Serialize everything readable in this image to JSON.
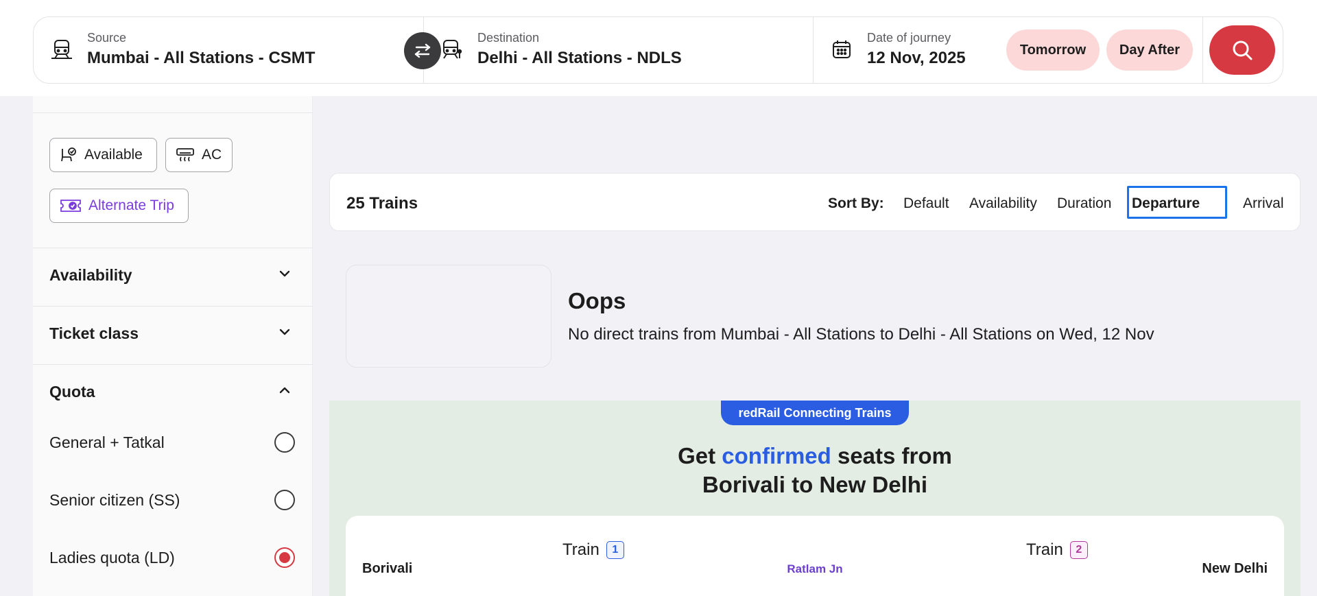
{
  "search": {
    "source": {
      "label": "Source",
      "value": "Mumbai - All Stations - CSMT",
      "icon": "train-icon"
    },
    "destination": {
      "label": "Destination",
      "value": "Delhi - All Stations - NDLS",
      "icon": "train-arrive-icon"
    },
    "date": {
      "label": "Date of journey",
      "value": "12 Nov, 2025",
      "icon": "calendar-icon"
    },
    "quick_dates": [
      "Tomorrow",
      "Day After"
    ],
    "accent_color": "#d63941"
  },
  "filters": {
    "chips": [
      {
        "label": "Available",
        "icon": "seat-check-icon"
      },
      {
        "label": "AC",
        "icon": "ac-icon"
      },
      {
        "label": "Alternate Trip",
        "icon": "ticket-icon"
      }
    ],
    "sections": [
      {
        "title": "Availability",
        "expanded": false
      },
      {
        "title": "Ticket class",
        "expanded": false
      },
      {
        "title": "Quota",
        "expanded": true
      }
    ],
    "quota_options": [
      {
        "label": "General + Tatkal",
        "selected": false
      },
      {
        "label": "Senior citizen (SS)",
        "selected": false
      },
      {
        "label": "Ladies quota (LD)",
        "selected": true
      }
    ]
  },
  "results": {
    "count": "25 Trains",
    "sort_label": "Sort By:",
    "sort_options": [
      "Default",
      "Availability",
      "Duration",
      "Departure",
      "Arrival"
    ],
    "sort_active": "Departure"
  },
  "empty_state": {
    "title": "Oops",
    "message": "No direct trains from Mumbai - All Stations to Delhi - All Stations on Wed, 12 Nov"
  },
  "connecting": {
    "badge": "redRail Connecting Trains",
    "headline_pre": "Get ",
    "headline_highlight": "confirmed",
    "headline_post": " seats from",
    "headline_line2": "Borivali to New Delhi",
    "from": "Borivali",
    "via": "Ratlam Jn",
    "to": "New Delhi",
    "train_label": "Train",
    "train_numbers": [
      "1",
      "2"
    ]
  }
}
